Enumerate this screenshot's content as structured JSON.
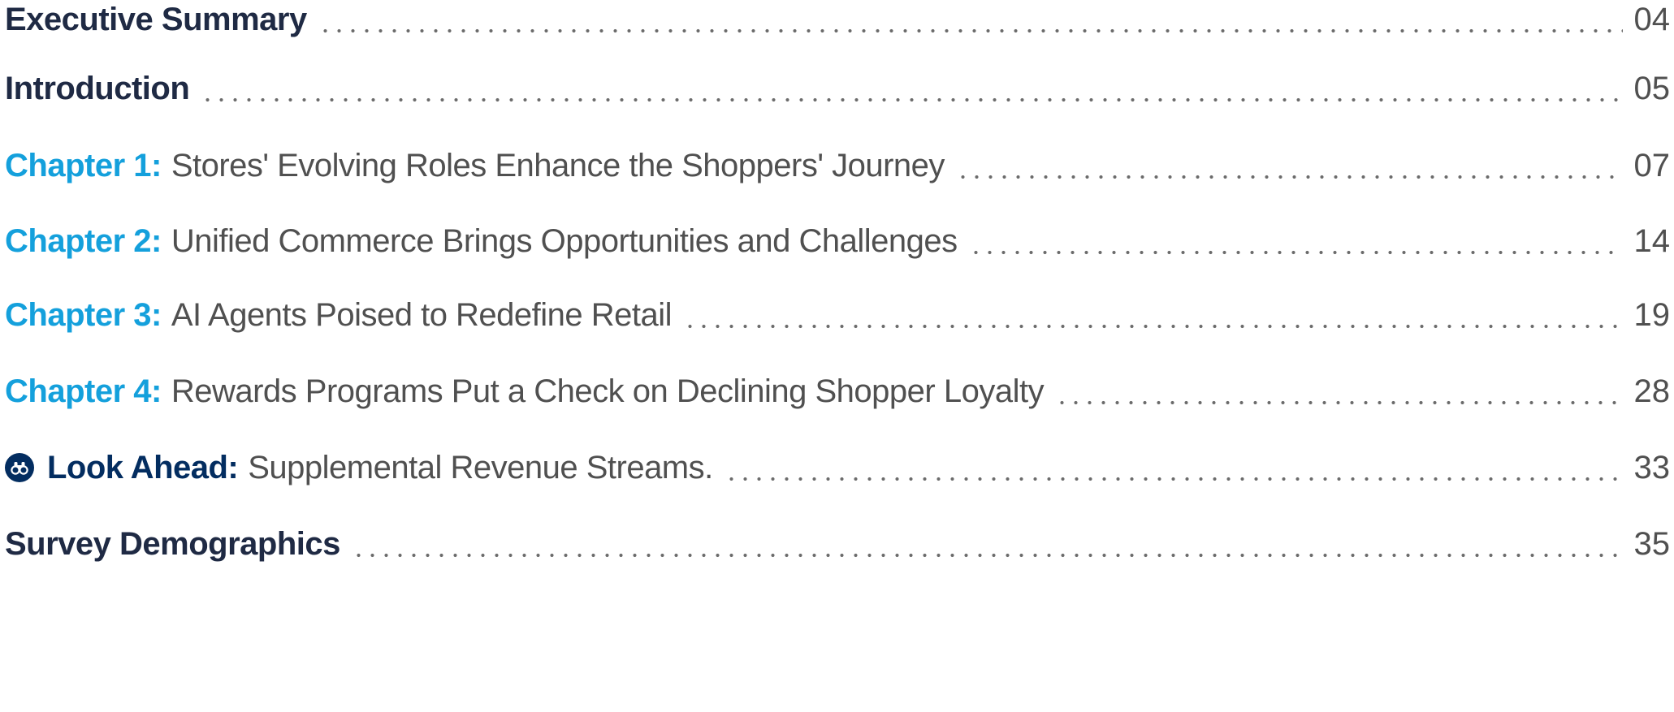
{
  "toc": {
    "entries": [
      {
        "label": "Executive Summary",
        "text": "",
        "page": "04",
        "style": "section"
      },
      {
        "label": "Introduction",
        "text": "",
        "page": "05",
        "style": "section"
      },
      {
        "label": "Chapter 1:",
        "text": "Stores' Evolving Roles Enhance the Shoppers' Journey",
        "page": "07",
        "style": "chapter"
      },
      {
        "label": "Chapter 2:",
        "text": "Unified Commerce Brings Opportunities and Challenges",
        "page": "14",
        "style": "chapter"
      },
      {
        "label": "Chapter 3:",
        "text": "AI Agents Poised to Redefine Retail",
        "page": "19",
        "style": "chapter"
      },
      {
        "label": "Chapter 4:",
        "text": "Rewards Programs Put a Check on Declining Shopper Loyalty",
        "page": "28",
        "style": "chapter"
      },
      {
        "label": "Look Ahead:",
        "text": "Supplemental Revenue Streams.",
        "page": "33",
        "style": "lookahead",
        "icon": "binoculars-icon"
      },
      {
        "label": "Survey Demographics",
        "text": "",
        "page": "35",
        "style": "section"
      }
    ]
  },
  "colors": {
    "section_label": "#1f2a44",
    "chapter_label": "#14a0dc",
    "lookahead_label": "#032d60",
    "body_text": "#505050",
    "leader_dots": "#6b6b6b"
  }
}
